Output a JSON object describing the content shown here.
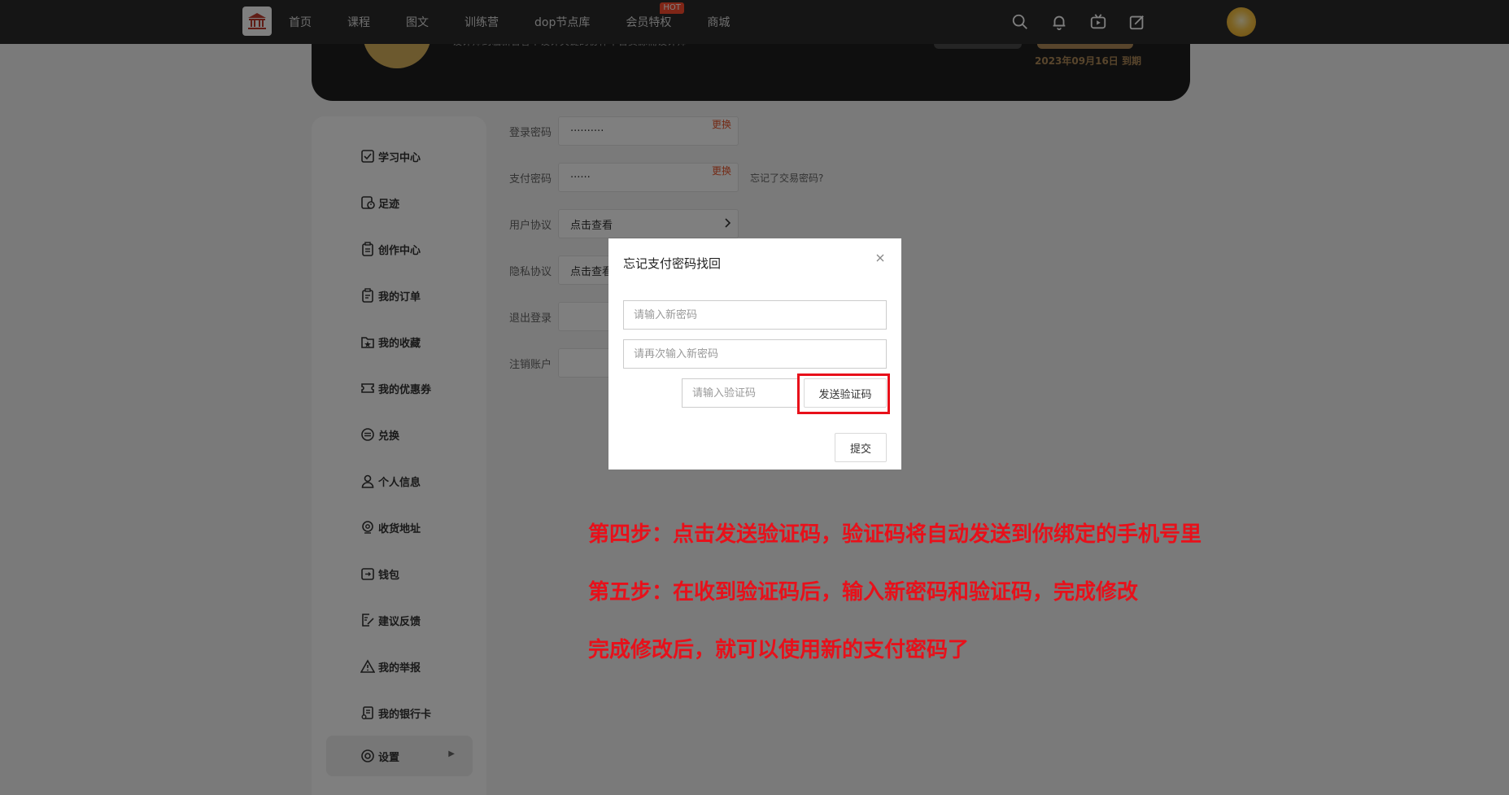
{
  "nav": {
    "items": [
      "首页",
      "课程",
      "图文",
      "训练营",
      "dop节点库",
      "会员特权",
      "商城"
    ],
    "hot_badge": "HOT"
  },
  "icons": {
    "logo": "temple-logo-icon",
    "search": "search-icon",
    "bell": "bell-icon",
    "tv": "tv-icon",
    "edit": "edit-icon"
  },
  "banner": {
    "desc": "设计师到临新合各个设计关键的协作平台资源需设计师",
    "expire": "2023年09月16日 到期"
  },
  "sidebar": {
    "items": [
      {
        "label": "学习中心",
        "icon": "study-icon"
      },
      {
        "label": "足迹",
        "icon": "footprint-icon"
      },
      {
        "label": "创作中心",
        "icon": "clipboard-icon"
      },
      {
        "label": "我的订单",
        "icon": "order-icon"
      },
      {
        "label": "我的收藏",
        "icon": "favorite-icon"
      },
      {
        "label": "我的优惠券",
        "icon": "coupon-icon"
      },
      {
        "label": "兑换",
        "icon": "exchange-icon"
      },
      {
        "label": "个人信息",
        "icon": "user-icon"
      },
      {
        "label": "收货地址",
        "icon": "location-icon"
      },
      {
        "label": "钱包",
        "icon": "wallet-icon"
      },
      {
        "label": "建议反馈",
        "icon": "feedback-icon"
      },
      {
        "label": "我的举报",
        "icon": "warning-icon"
      },
      {
        "label": "我的银行卡",
        "icon": "bank-card-icon"
      },
      {
        "label": "设置",
        "icon": "settings-icon"
      }
    ],
    "active_arrow": "▶"
  },
  "settings": {
    "login_password": {
      "label": "登录密码",
      "value": "··········",
      "action": "更换"
    },
    "pay_password": {
      "label": "支付密码",
      "value": "······",
      "action": "更换",
      "forgot": "忘记了交易密码?"
    },
    "user_agreement": {
      "label": "用户协议",
      "value": "点击查看"
    },
    "privacy": {
      "label": "隐私协议",
      "value": "点击查看"
    },
    "logout": {
      "label": "退出登录"
    },
    "delete_account": {
      "label": "注销账户"
    }
  },
  "modal": {
    "title": "忘记支付密码找回",
    "new_password_placeholder": "请输入新密码",
    "confirm_password_placeholder": "请再次输入新密码",
    "code_placeholder": "请输入验证码",
    "send_code_label": "发送验证码",
    "submit_label": "提交"
  },
  "notes": {
    "step4": "第四步：点击发送验证码，验证码将自动发送到你绑定的手机号里",
    "step5": "第五步：在收到验证码后，输入新密码和验证码，完成修改",
    "done": "完成修改后，就可以使用新的支付密码了"
  },
  "colors": {
    "accent_red": "#e8101a",
    "change_link": "#e8542a",
    "hot_badge": "#ff4d2e",
    "gold": "#b08a58"
  }
}
